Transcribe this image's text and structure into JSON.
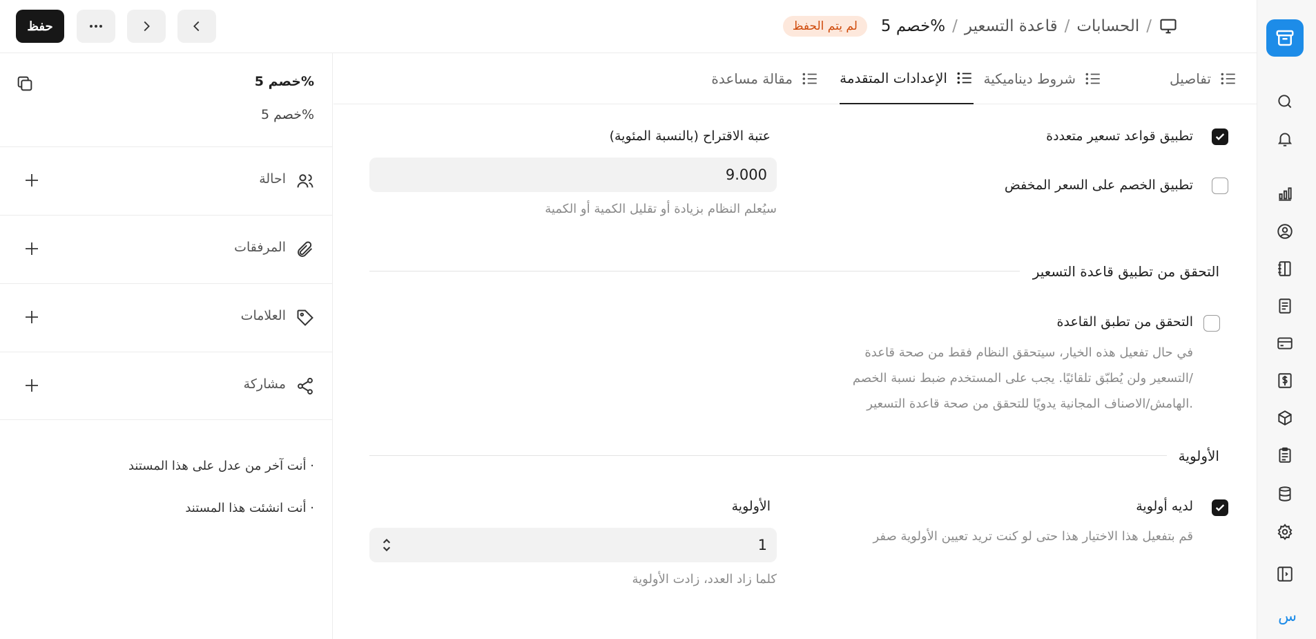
{
  "header": {
    "breadcrumbs": [
      "الحسابات",
      "قاعدة التسعير",
      "خصم 5%"
    ],
    "status_badge": "لم يتم الحفظ",
    "save_label": "حفظ"
  },
  "sidebar_panel": {
    "title": "خصم 5%",
    "subtitle": "خصم 5%",
    "rows": [
      {
        "label": "احالة",
        "icon": "users-icon"
      },
      {
        "label": "المرفقات",
        "icon": "paperclip-icon"
      },
      {
        "label": "العلامات",
        "icon": "tag-icon"
      },
      {
        "label": "مشاركة",
        "icon": "share-icon"
      }
    ],
    "notes": [
      "أنت آخر من عدل على هذا المستند ·",
      "أنت انشئت هذا المستند ·"
    ]
  },
  "tabs": [
    {
      "label": "تفاصيل",
      "active": false
    },
    {
      "label": "شروط ديناميكية",
      "active": false
    },
    {
      "label": "الإعدادات المتقدمة",
      "active": true
    },
    {
      "label": "مقالة مساعدة",
      "active": false
    }
  ],
  "form": {
    "multiple_rules": {
      "label": "تطبيق قواعد تسعير متعددة",
      "checked": true
    },
    "discount_on_discounted": {
      "label": "تطبيق الخصم على السعر المخفض",
      "checked": false
    },
    "threshold": {
      "label": "عتبة الاقتراح (بالنسبة المئوية)",
      "value": "9.000",
      "description": "سيُعلم النظام بزيادة أو تقليل الكمية أو الكمية"
    },
    "validation_section": {
      "title": "التحقق من تطبيق قاعدة التسعير",
      "checkbox_label": "التحقق من تطبق القاعدة",
      "checked": false,
      "description_lines": [
        "في حال تفعيل هذه الخيار، سيتحقق النظام فقط من صحة قاعدة",
        "التسعير ولن يُطبّق تلقائيًا. يجب على المستخدم ضبط نسبة الخصم/",
        "الهامش/الاصناف المجانية يدويًا للتحقق من صحة قاعدة التسعير."
      ]
    },
    "priority_section": {
      "title": "الأولوية",
      "has_priority_label": "لديه أولوية",
      "has_priority_checked": true,
      "has_priority_description": "قم بتفعيل هذا الاختيار هذا حتى لو كنت تريد تعيين الأولوية صفر",
      "priority_label": "الأولوية",
      "priority_value": "1",
      "priority_description": "كلما زاد العدد، زادت الأولوية"
    }
  },
  "rail": {
    "icons": [
      "search-icon",
      "bell-icon",
      "chart-icon",
      "user-circle-icon",
      "notebook-icon",
      "document-icon",
      "card-icon",
      "invoice-icon",
      "box-icon",
      "clipboard-icon",
      "database-icon",
      "gear-icon",
      "sidebar-toggle-icon"
    ],
    "language_label": "س"
  },
  "colors": {
    "accent": "#1d8ce8",
    "badge_bg": "#fde8dc",
    "badge_text": "#cf4a0a",
    "dark_button": "#171717"
  }
}
